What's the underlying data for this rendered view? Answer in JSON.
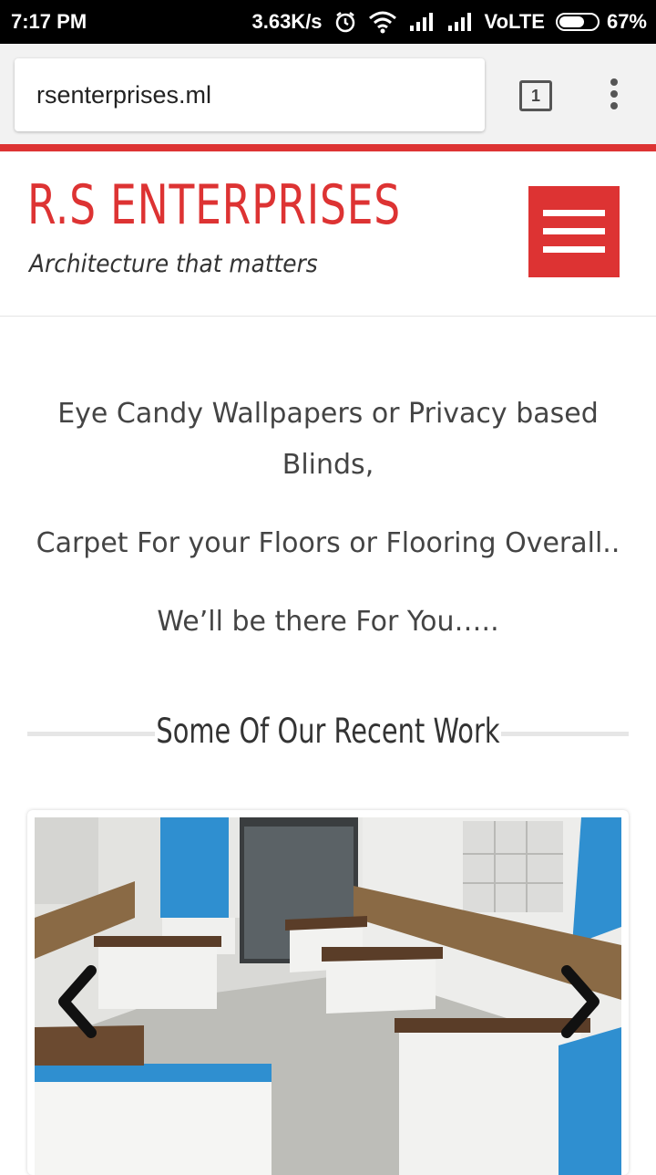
{
  "status_bar": {
    "time": "7:17 PM",
    "speed": "3.63K/s",
    "network": "VoLTE",
    "battery_percent": "67%",
    "battery_level": 0.67
  },
  "browser": {
    "url": "rsenterprises.ml",
    "tab_count": "1"
  },
  "site": {
    "title": "R.S ENTERPRISES",
    "tagline": "Architecture that matters",
    "brand_color": "#dd3333"
  },
  "intro": {
    "line1": "Eye Candy Wallpapers or  Privacy based Blinds,",
    "line2": "Carpet For your Floors or Flooring Overall..",
    "line3": "We’ll be there For You….."
  },
  "recent_work": {
    "heading": "Some Of Our Recent Work"
  },
  "icons": {
    "clock": "alarm-icon",
    "wifi": "wifi-icon",
    "signal": "signal-icon",
    "menu": "hamburger-icon",
    "more": "more-vert-icon",
    "prev": "chevron-left-icon",
    "next": "chevron-right-icon"
  }
}
